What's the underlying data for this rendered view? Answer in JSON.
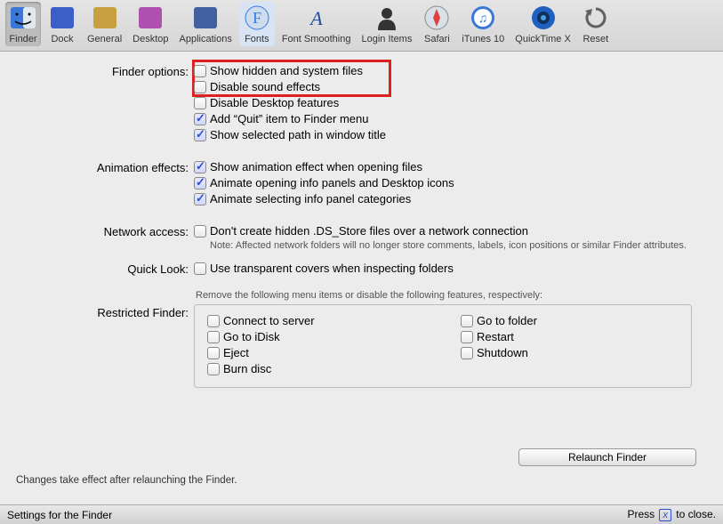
{
  "toolbar": [
    {
      "name": "finder",
      "label": "Finder",
      "selected": true
    },
    {
      "name": "dock",
      "label": "Dock"
    },
    {
      "name": "general",
      "label": "General"
    },
    {
      "name": "desktop",
      "label": "Desktop"
    },
    {
      "name": "applications",
      "label": "Applications"
    },
    {
      "name": "fonts",
      "label": "Fonts",
      "hl": true
    },
    {
      "name": "font-smoothing",
      "label": "Font Smoothing"
    },
    {
      "name": "login-items",
      "label": "Login Items"
    },
    {
      "name": "safari",
      "label": "Safari"
    },
    {
      "name": "itunes10",
      "label": "iTunes 10"
    },
    {
      "name": "quicktime-x",
      "label": "QuickTime X"
    },
    {
      "name": "reset",
      "label": "Reset"
    }
  ],
  "sections": {
    "finder_options": {
      "label": "Finder options:",
      "items": [
        {
          "label": "Show hidden and system files",
          "checked": false
        },
        {
          "label": "Disable sound effects",
          "checked": false
        },
        {
          "label": "Disable Desktop features",
          "checked": false
        },
        {
          "label": "Add “Quit” item to Finder menu",
          "checked": true
        },
        {
          "label": "Show selected path in window title",
          "checked": true
        }
      ]
    },
    "animation": {
      "label": "Animation effects:",
      "items": [
        {
          "label": "Show animation effect when opening files",
          "checked": true
        },
        {
          "label": "Animate opening info panels and Desktop icons",
          "checked": true
        },
        {
          "label": "Animate selecting info panel categories",
          "checked": true
        }
      ]
    },
    "network": {
      "label": "Network access:",
      "items": [
        {
          "label": "Don't create hidden .DS_Store files over a network connection",
          "checked": false
        }
      ],
      "note": "Note: Affected network folders will no longer store comments, labels, icon positions or similar Finder attributes."
    },
    "quicklook": {
      "label": "Quick Look:",
      "items": [
        {
          "label": "Use transparent covers when inspecting folders",
          "checked": false
        }
      ]
    },
    "restricted": {
      "label": "Restricted Finder:",
      "note": "Remove the following menu items or disable the following features, respectively:",
      "left": [
        {
          "label": "Connect to server",
          "checked": false
        },
        {
          "label": "Go to iDisk",
          "checked": false
        },
        {
          "label": "Eject",
          "checked": false
        },
        {
          "label": "Burn disc",
          "checked": false
        }
      ],
      "right": [
        {
          "label": "Go to folder",
          "checked": false
        },
        {
          "label": "Restart",
          "checked": false
        },
        {
          "label": "Shutdown",
          "checked": false
        }
      ]
    }
  },
  "buttons": {
    "relaunch": "Relaunch Finder"
  },
  "footer": {
    "relaunch_note": "Changes take effect after relaunching the Finder.",
    "status_left": "Settings for the Finder",
    "status_press": "Press ",
    "status_close": " to close.",
    "close_key": "x"
  }
}
